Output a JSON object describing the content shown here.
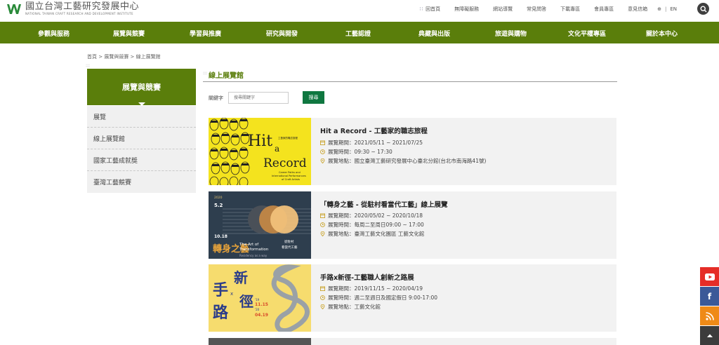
{
  "header": {
    "logo_zh": "國立台灣工藝研究發展中心",
    "logo_en": "NATIONAL TAIWAN CRAFT RESEARCH AND DEVELOPMENT INSTITUTE",
    "util_links": [
      "回首頁",
      "無障礙服務",
      "網站導覽",
      "常見問答",
      "下載專區",
      "會員專區",
      "意見信箱"
    ],
    "lang_icon": "⊕",
    "lang_sep": "|",
    "lang_en": "EN"
  },
  "nav": {
    "items": [
      "參觀與服務",
      "展覽與競賽",
      "學習與推廣",
      "研究與開發",
      "工藝認證",
      "典藏與出版",
      "旅遊與購物",
      "文化平權專區",
      "關於本中心"
    ]
  },
  "breadcrumb": "首頁 > 展覽與競賽 > 線上展覽館",
  "sidebar": {
    "title": "展覽與競賽",
    "items": [
      "展覽",
      "線上展覽館",
      "國家工藝成就獎",
      "臺灣工藝競賽"
    ]
  },
  "content": {
    "title": "線上展覽館",
    "search_label": "關鍵字",
    "search_placeholder": "搜尋關鍵字",
    "search_button": "搜尋"
  },
  "exhibitions": [
    {
      "title": "Hit a Record - 工藝家的職志旅程",
      "period": "展覽期間：2021/05/11 ~ 2021/07/25",
      "hours": "展覽時間：09:30 ~ 17:30",
      "location": "展覽地點：國立臺灣工藝研究發展中心臺北分館(台北市南海路41號)",
      "poster": {
        "big_hit": "Hit",
        "big_a": "a",
        "big_record": "Record",
        "sub1": "Career Paths and",
        "sub2": "International Performances",
        "sub3": "of Craft Artists",
        "zh": "工藝家的職志旅程"
      }
    },
    {
      "title": "「轉身之藝 - 從駐村看當代工藝」線上展覽",
      "period": "展覽期間：2020/05/02 ~ 2020/10/18",
      "hours": "展覽時間：每周二至周日09:00 ~ 17:00",
      "location": "展覽地點：臺灣工藝文化園區 工藝文化館",
      "poster": {
        "year": "2020",
        "date1": "5.2",
        "date2": "10.18",
        "en1": "The Art of",
        "en2": "Transformation",
        "en3": "Residency as a way",
        "zh1": "從駐村",
        "zh2": "看當代工藝",
        "zh_big": "轉身之藝"
      }
    },
    {
      "title": "手路x新徑-工藝職人創新之路展",
      "period": "展覽期間：2019/11/15 ~ 2020/04/19",
      "hours": "展覽時間：週二至週日及國定假日 9:00-17:00",
      "location": "展覽地點：工藝文化館",
      "poster": {
        "zh_big1": "手",
        "zh_big2": "路",
        "zh_big3": "新",
        "zh_big4": "徑",
        "x": "x",
        "d1": "'19",
        "d2": "11.15",
        "d3": "'20",
        "d4": "04.19"
      }
    }
  ],
  "colors": {
    "brand_green": "#5a7e0b",
    "button_green": "#0f7740",
    "card_bg": "#f2f2f2",
    "icon_gold": "#c9a227"
  }
}
